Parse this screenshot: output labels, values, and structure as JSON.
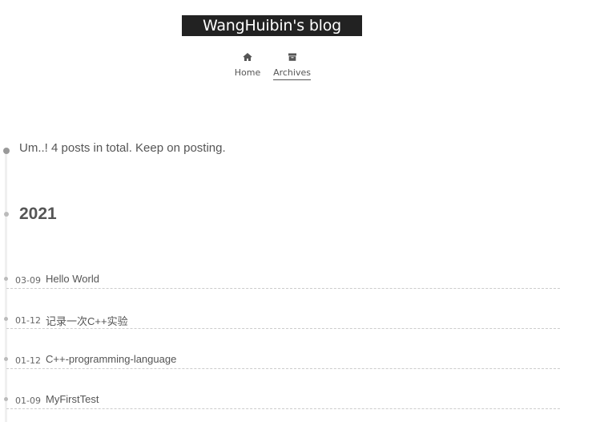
{
  "site": {
    "title": "WangHuibin's blog"
  },
  "menu": {
    "items": [
      {
        "label": "Home",
        "icon": "home-icon"
      },
      {
        "label": "Archives",
        "icon": "archive-icon",
        "active": true
      }
    ]
  },
  "archive": {
    "summary": "Um..! 4 posts in total. Keep on posting.",
    "year": "2021",
    "posts": [
      {
        "date": "03-09",
        "title": "Hello World"
      },
      {
        "date": "01-12",
        "title": "记录一次C++实验"
      },
      {
        "date": "01-12",
        "title": "C++-programming-language"
      },
      {
        "date": "01-09",
        "title": "MyFirstTest"
      }
    ]
  },
  "colors": {
    "brand_bg": "#222222",
    "brand_text": "#ffffff",
    "text": "#555555",
    "timeline": "#f0f0f0",
    "divider": "#cccccc"
  }
}
